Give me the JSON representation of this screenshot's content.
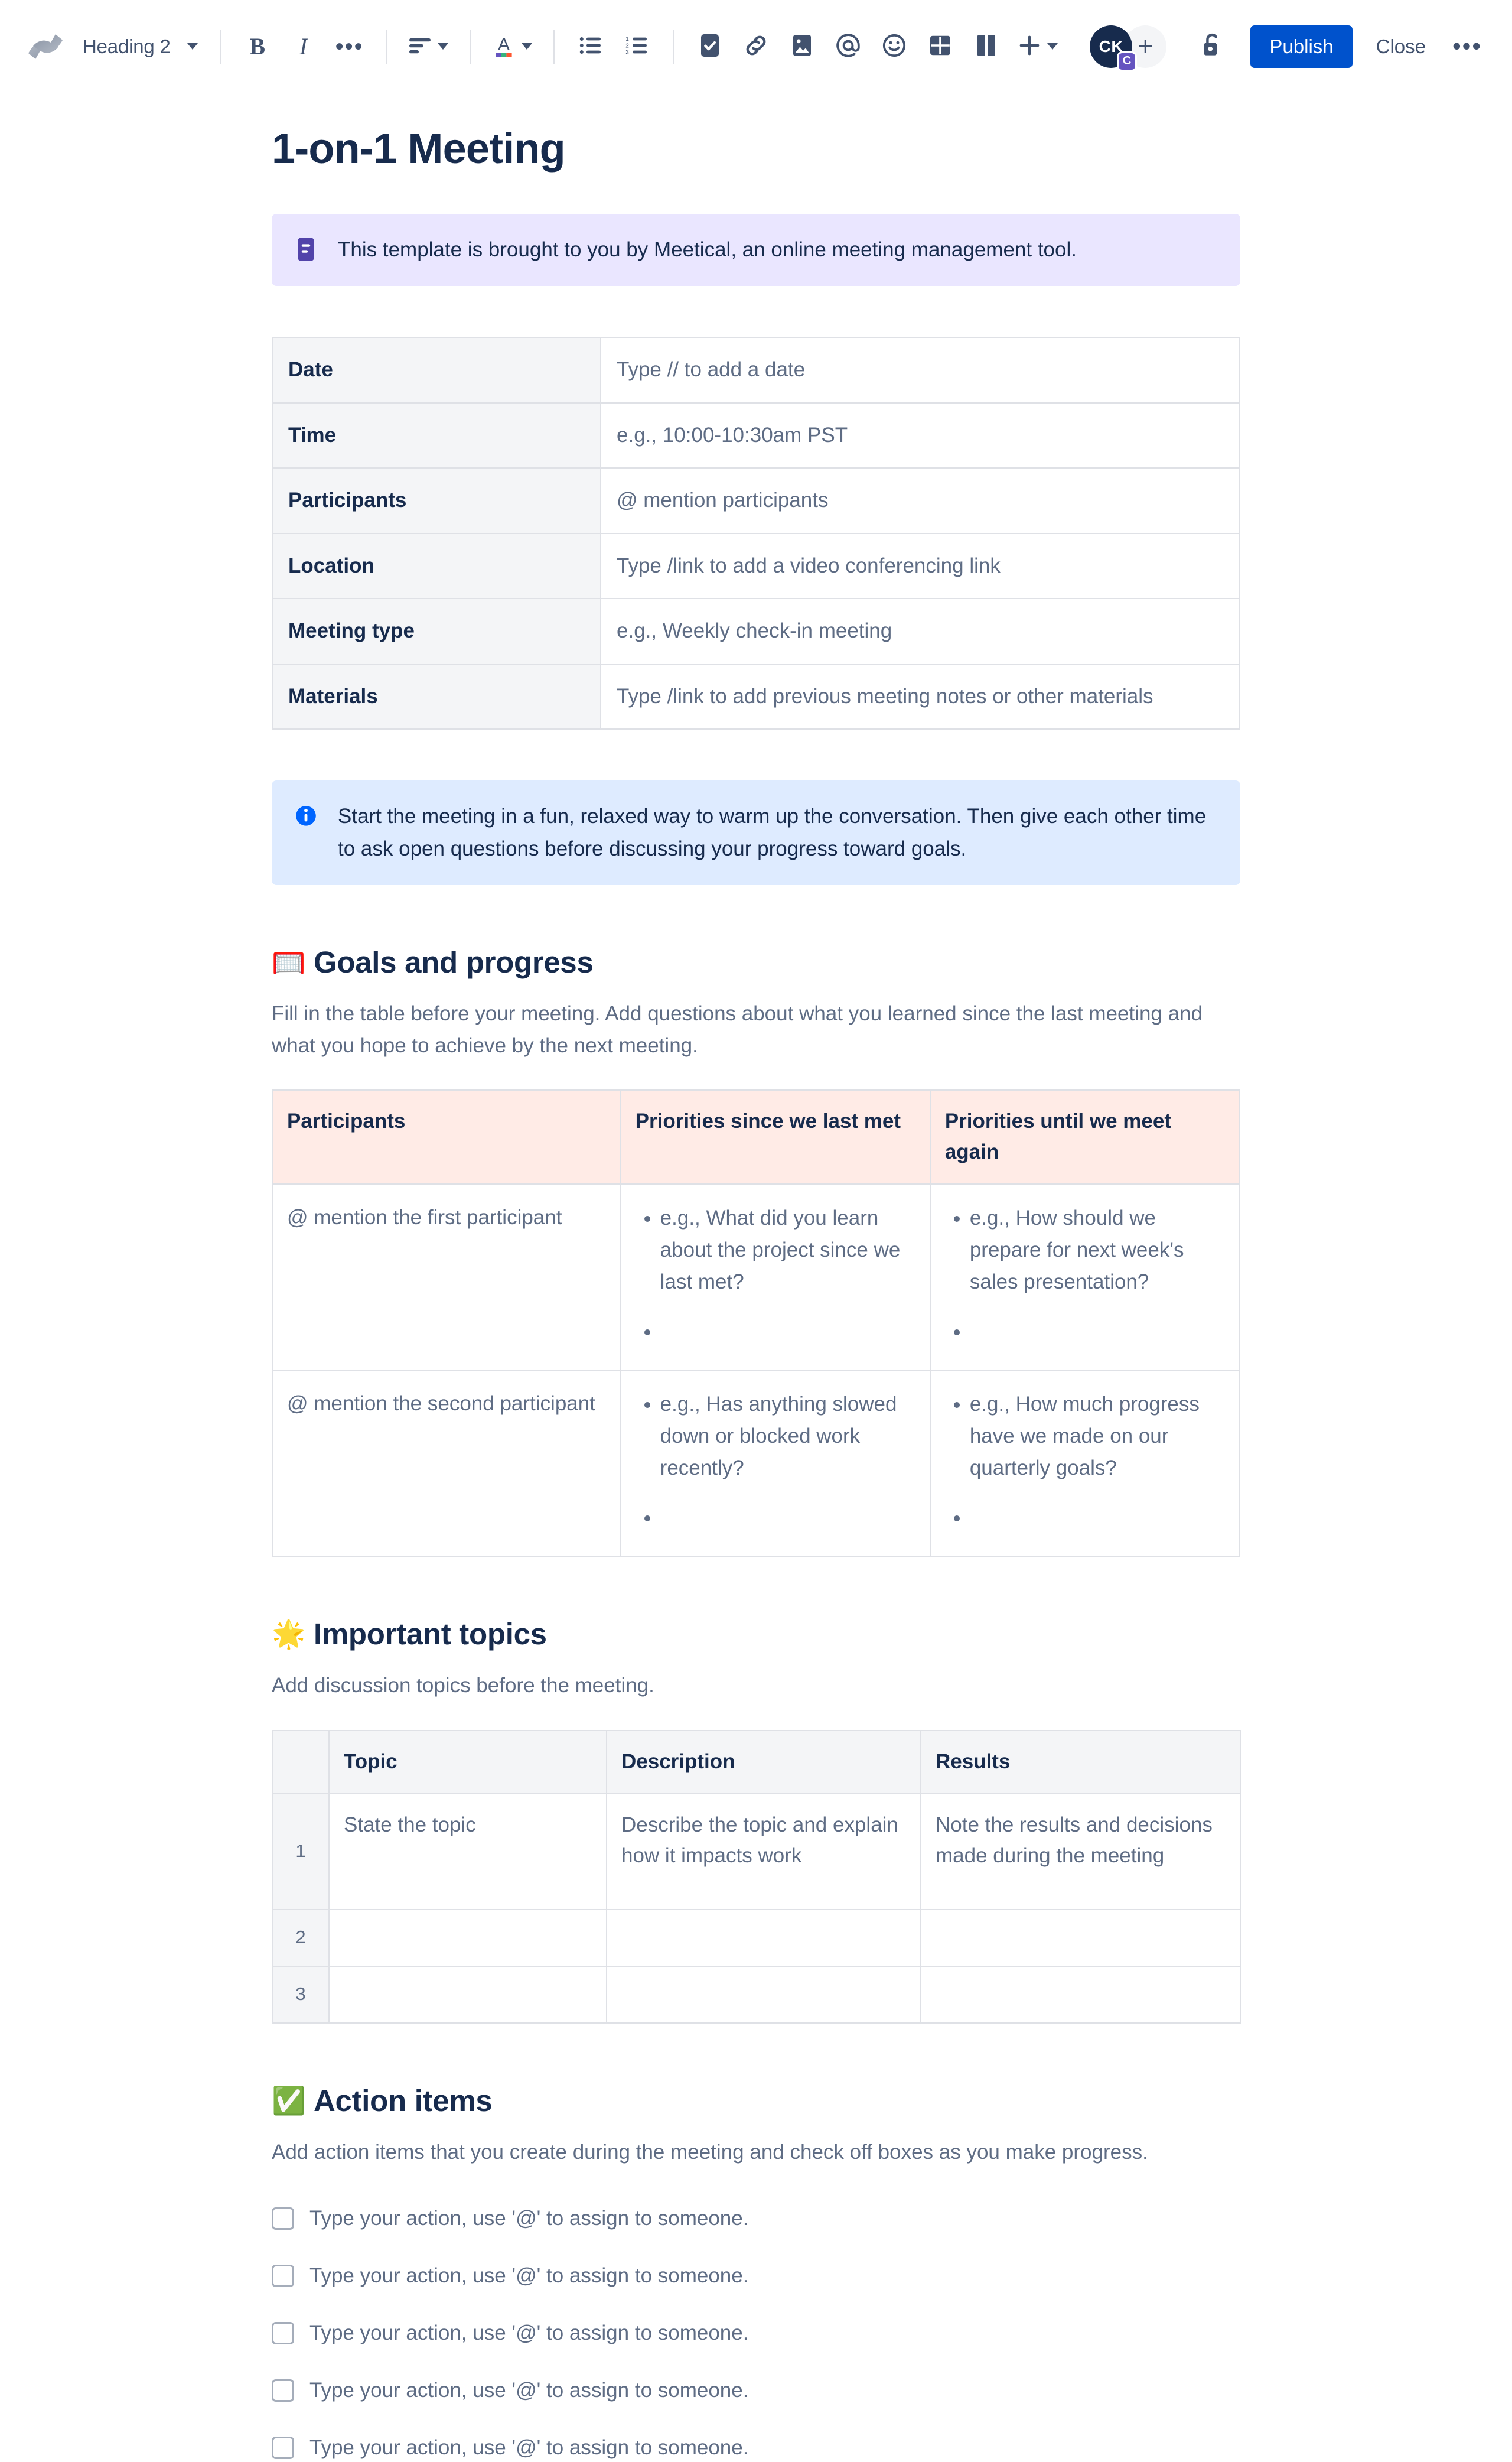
{
  "toolbar": {
    "logo_icon": "confluence-logo-icon",
    "style_select": {
      "label": "Heading 2",
      "icon": "chevron-down-icon"
    },
    "bold": {
      "label": "B",
      "icon": "bold-icon"
    },
    "italic": {
      "label": "I",
      "icon": "italic-icon"
    },
    "more_formatting": {
      "label": "•••",
      "icon": "more-formatting-icon"
    },
    "align": {
      "icon": "text-align-icon"
    },
    "text_color": {
      "label": "A",
      "icon": "text-color-icon"
    },
    "bullet_list": {
      "icon": "bullet-list-icon"
    },
    "numbered_list": {
      "icon": "numbered-list-icon"
    },
    "task": {
      "icon": "task-checkbox-icon"
    },
    "link": {
      "icon": "link-icon"
    },
    "image": {
      "icon": "image-icon"
    },
    "mention": {
      "icon": "mention-at-icon"
    },
    "emoji": {
      "icon": "emoji-smiley-icon"
    },
    "table": {
      "icon": "table-icon"
    },
    "layout": {
      "icon": "layout-columns-icon"
    },
    "insert": {
      "label": "+",
      "icon": "plus-icon"
    },
    "avatar": {
      "initials": "CK",
      "badge": "C"
    },
    "add_people": {
      "label": "+",
      "icon": "add-person-icon"
    },
    "restrictions": {
      "icon": "unlock-icon"
    },
    "publish_label": "Publish",
    "close_label": "Close",
    "more_label": "•••",
    "publish_color": "#0052CC"
  },
  "document": {
    "title": "1-on-1 Meeting",
    "note_panel": {
      "icon": "note-panel-icon",
      "text": "This template is brought to you by Meetical, an online meeting management tool.",
      "bg": "#EAE6FF",
      "icon_color": "#5243AA"
    },
    "meta_table": {
      "rows": [
        {
          "label": "Date",
          "value": "Type // to add a date"
        },
        {
          "label": "Time",
          "value": "e.g., 10:00-10:30am PST"
        },
        {
          "label": "Participants",
          "value": "@ mention participants"
        },
        {
          "label": "Location",
          "value": "Type /link to add a video conferencing link"
        },
        {
          "label": "Meeting type",
          "value": "e.g., Weekly check-in meeting"
        },
        {
          "label": "Materials",
          "value": "Type /link to add previous meeting notes or other materials"
        }
      ]
    },
    "info_panel": {
      "icon": "info-panel-icon",
      "text": "Start the meeting in a fun, relaxed way to warm up the conversation. Then give each other time to ask open questions before discussing your progress toward goals.",
      "bg": "#DEEBFF",
      "icon_color": "#0065FF"
    },
    "goals_section": {
      "emoji": "🥅",
      "emoji_name": "goal-net-emoji",
      "heading": "Goals and progress",
      "description": "Fill in the table before your meeting. Add questions about what you learned since the last meeting and what you hope to achieve by the next meeting.",
      "table": {
        "headers": [
          "Participants",
          "Priorities since we last met",
          "Priorities until we meet again"
        ],
        "header_bg": "#FFEBE6",
        "rows": [
          {
            "participant": "@ mention the first participant",
            "since": [
              "e.g., What did you learn about the project since we last met?",
              ""
            ],
            "until": [
              "e.g., How should we prepare for next week's sales presentation?",
              ""
            ]
          },
          {
            "participant": "@ mention the second participant",
            "since": [
              "e.g., Has anything slowed down or blocked work recently?",
              ""
            ],
            "until": [
              "e.g., How much progress have we made on our quarterly goals?",
              ""
            ]
          }
        ]
      }
    },
    "topics_section": {
      "emoji": "🌟",
      "emoji_name": "glowing-star-emoji",
      "heading": "Important topics",
      "description": "Add discussion topics before the meeting.",
      "table": {
        "headers": [
          "",
          "Topic",
          "Description",
          "Results"
        ],
        "rows": [
          {
            "num": "1",
            "topic": "State the topic",
            "description": "Describe the topic and explain how it impacts work",
            "results": "Note the results and decisions made during the meeting"
          },
          {
            "num": "2",
            "topic": "",
            "description": "",
            "results": ""
          },
          {
            "num": "3",
            "topic": "",
            "description": "",
            "results": ""
          }
        ]
      }
    },
    "action_section": {
      "emoji": "✅",
      "emoji_name": "check-mark-button-emoji",
      "heading": "Action items",
      "description": "Add action items that you create during the meeting and check off boxes as you make progress.",
      "items": [
        {
          "checked": false,
          "text": "Type your action, use '@' to assign to someone."
        },
        {
          "checked": false,
          "text": "Type your action, use '@' to assign to someone."
        },
        {
          "checked": false,
          "text": "Type your action, use '@' to assign to someone."
        },
        {
          "checked": false,
          "text": "Type your action, use '@' to assign to someone."
        },
        {
          "checked": false,
          "text": "Type your action, use '@' to assign to someone."
        }
      ]
    }
  }
}
